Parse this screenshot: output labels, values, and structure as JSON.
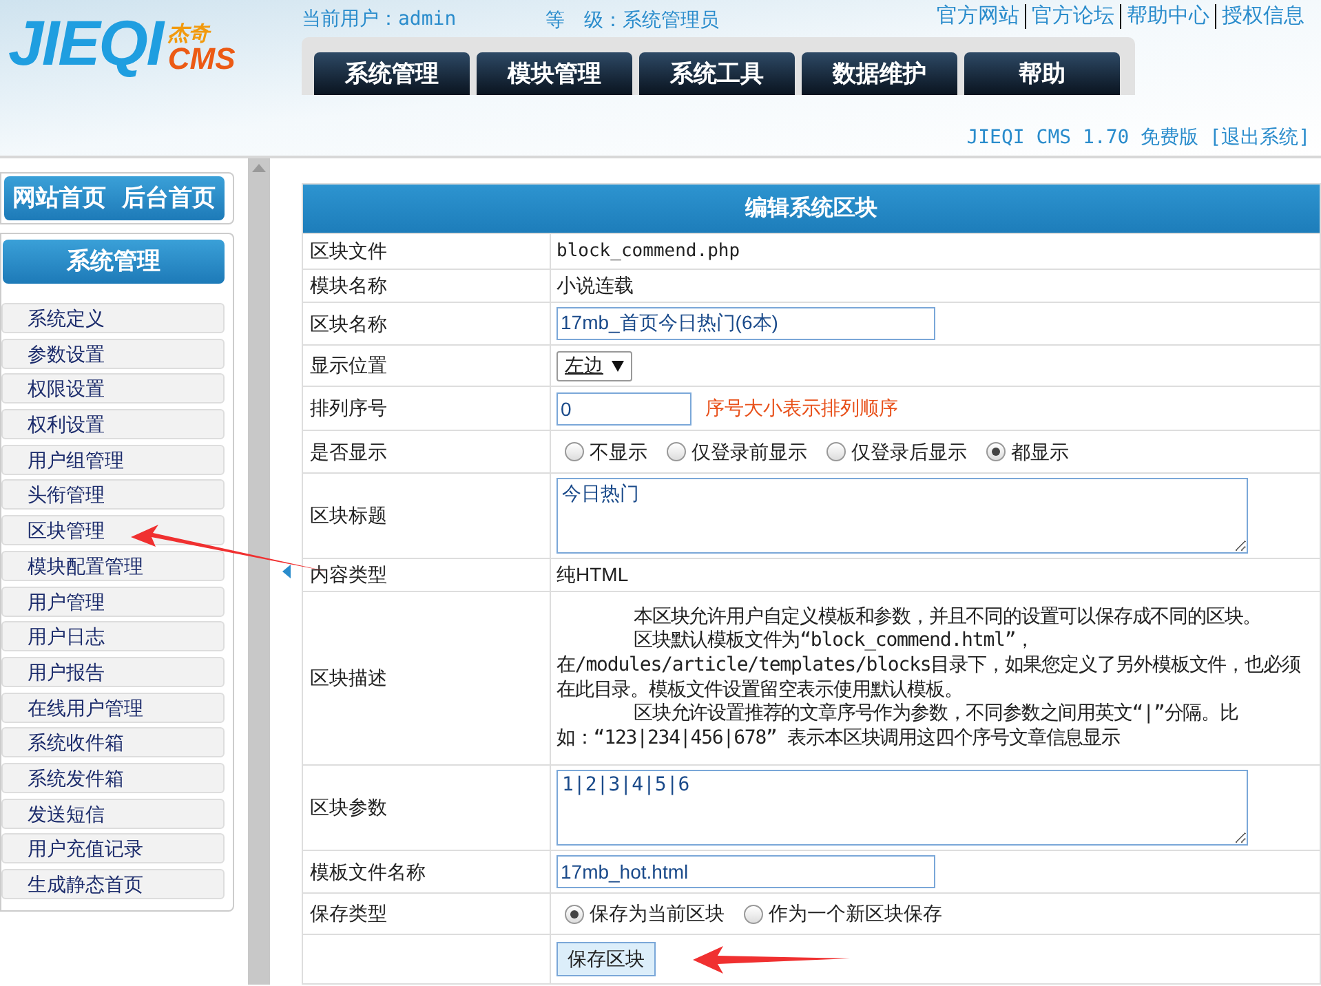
{
  "header": {
    "logo": {
      "mark": "JIEQI",
      "cn": "杰奇",
      "cms": "CMS"
    },
    "user": "当前用户：admin",
    "level": "等　级：系统管理员",
    "links": [
      "官方网站",
      "官方论坛",
      "帮助中心",
      "授权信息"
    ],
    "tabs": [
      "系统管理",
      "模块管理",
      "系统工具",
      "数据维护",
      "帮助"
    ],
    "version": "JIEQI CMS 1.70 免费版",
    "logout": "[退出系统]"
  },
  "sidebar": {
    "top_buttons": [
      "网站首页",
      "后台首页"
    ],
    "section_title": "系统管理",
    "items": [
      "系统定义",
      "参数设置",
      "权限设置",
      "权利设置",
      "用户组管理",
      "头衔管理",
      "区块管理",
      "模块配置管理",
      "用户管理",
      "用户日志",
      "用户报告",
      "在线用户管理",
      "系统收件箱",
      "系统发件箱",
      "发送短信",
      "用户充值记录",
      "生成静态首页"
    ]
  },
  "form": {
    "title": "编辑系统区块",
    "rows": [
      {
        "kind": "text",
        "label": "区块文件",
        "value": "block_commend.php"
      },
      {
        "kind": "text",
        "label": "模块名称",
        "value": "小说连载"
      },
      {
        "kind": "input",
        "label": "区块名称",
        "value": "17mb_首页今日热门(6本)"
      },
      {
        "kind": "select",
        "label": "显示位置",
        "value": "左边"
      },
      {
        "kind": "input_hint",
        "label": "排列序号",
        "value": "0",
        "hint": "序号大小表示排列顺序"
      },
      {
        "kind": "radio",
        "label": "是否显示",
        "options": [
          {
            "label": "不显示",
            "selected": false
          },
          {
            "label": "仅登录前显示",
            "selected": false
          },
          {
            "label": "仅登录后显示",
            "selected": false
          },
          {
            "label": "都显示",
            "selected": true
          }
        ]
      },
      {
        "kind": "textarea",
        "label": "区块标题",
        "value": "今日热门"
      },
      {
        "kind": "text",
        "label": "内容类型",
        "value": "纯HTML"
      },
      {
        "kind": "description",
        "label": "区块描述",
        "paragraphs": [
          "本区块允许用户自定义模板和参数，并且不同的设置可以保存成不同的区块。",
          "区块默认模板文件为“block_commend.html”，在/modules/article/templates/blocks目录下，如果您定义了另外模板文件，也必须在此目录。模板文件设置留空表示使用默认模板。",
          "区块允许设置推荐的文章序号作为参数，不同参数之间用英文“|”分隔。比如：“123|234|456|678” 表示本区块调用这四个序号文章信息显示"
        ]
      },
      {
        "kind": "textarea",
        "label": "区块参数",
        "value": "1|2|3|4|5|6"
      },
      {
        "kind": "input",
        "label": "模板文件名称",
        "value": "17mb_hot.html"
      },
      {
        "kind": "radio",
        "label": "保存类型",
        "options": [
          {
            "label": "保存为当前区块",
            "selected": true
          },
          {
            "label": "作为一个新区块保存",
            "selected": false
          }
        ]
      },
      {
        "kind": "button",
        "label": "",
        "value": "保存区块"
      }
    ]
  }
}
